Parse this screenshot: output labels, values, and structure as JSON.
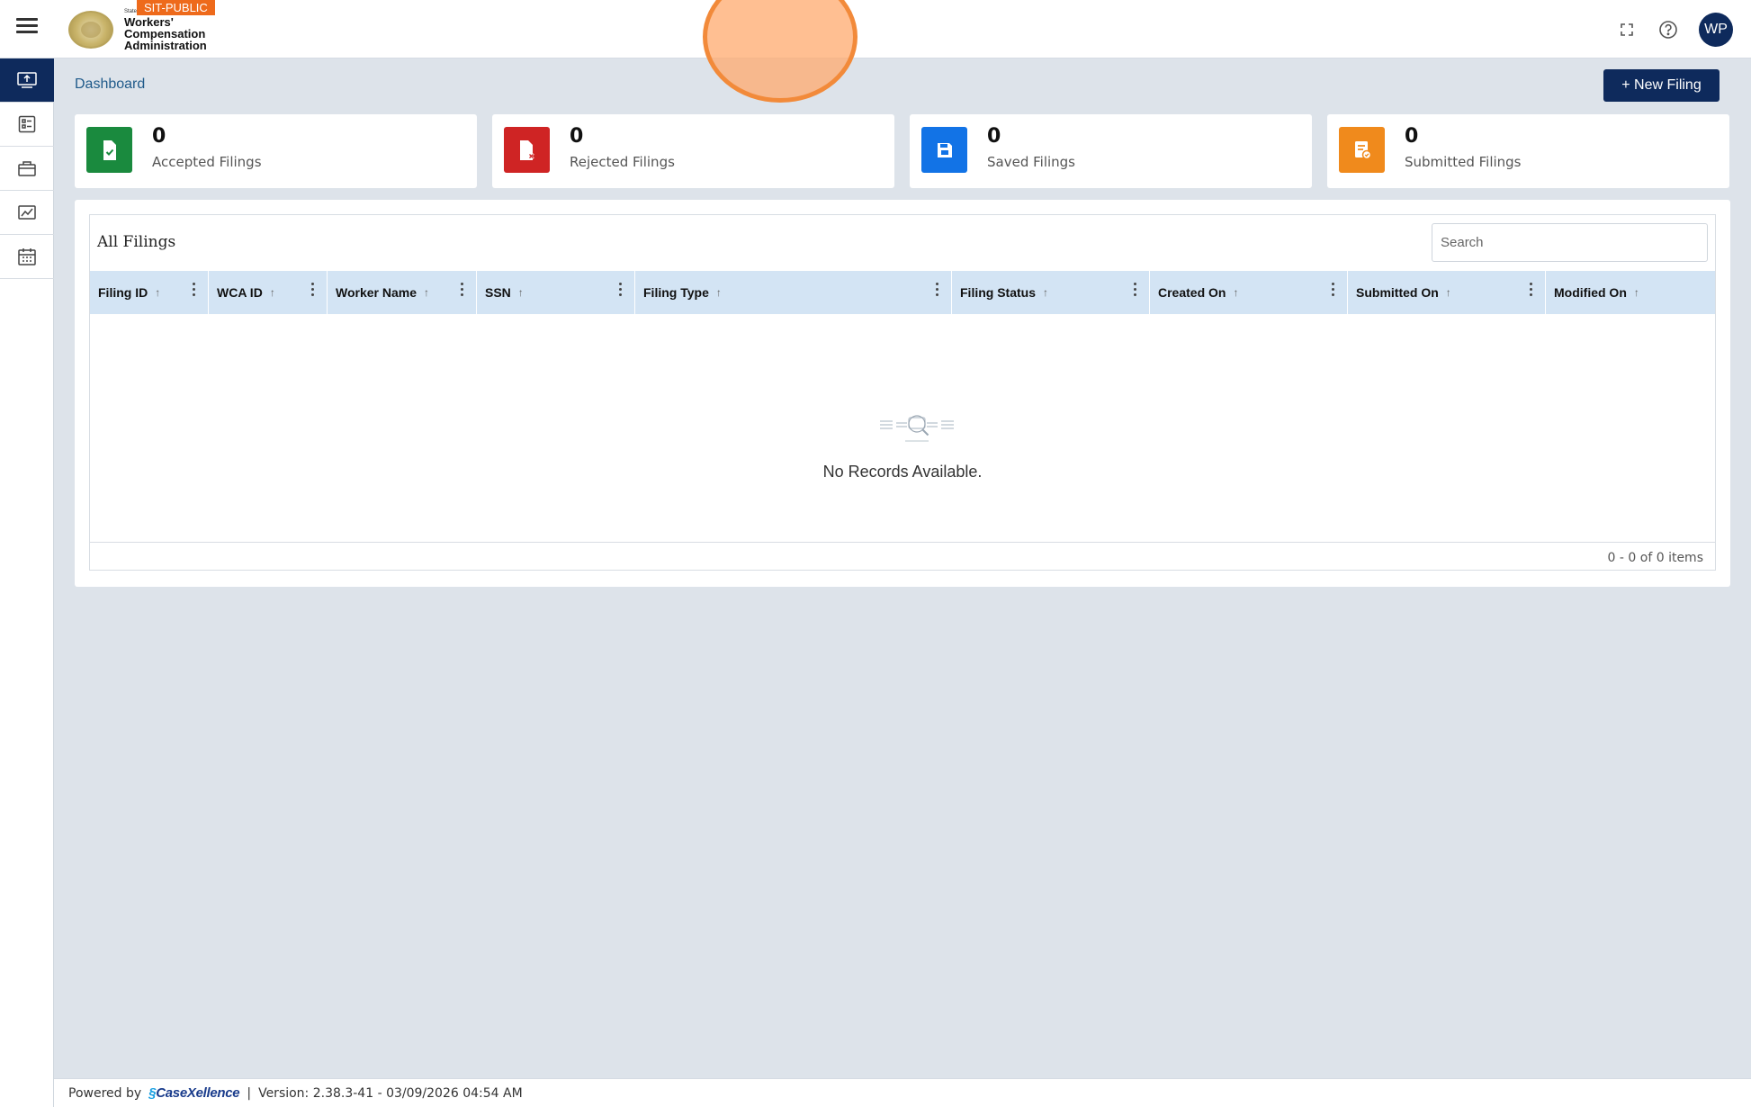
{
  "header": {
    "env_badge": "SIT-PUBLIC",
    "org_small": "State",
    "org_line1": "Workers'",
    "org_line2": "Compensation",
    "org_line3": "Administration",
    "avatar_initials": "WP",
    "icons": [
      "menu-icon",
      "fullscreen-icon",
      "help-icon"
    ]
  },
  "sidebar": {
    "items": [
      {
        "icon": "dashboard-icon",
        "active": true
      },
      {
        "icon": "list-icon",
        "active": false
      },
      {
        "icon": "briefcase-icon",
        "active": false
      },
      {
        "icon": "chart-icon",
        "active": false
      },
      {
        "icon": "calendar-icon",
        "active": false
      }
    ]
  },
  "breadcrumb": "Dashboard",
  "new_filing_label": "+ New Filing",
  "stats": [
    {
      "value": "0",
      "label": "Accepted Filings",
      "color": "#1a8a3e",
      "icon": "file-check-icon"
    },
    {
      "value": "0",
      "label": "Rejected Filings",
      "color": "#cf2424",
      "icon": "file-x-icon"
    },
    {
      "value": "0",
      "label": "Saved Filings",
      "color": "#1273e6",
      "icon": "save-icon"
    },
    {
      "value": "0",
      "label": "Submitted Filings",
      "color": "#f08a1c",
      "icon": "file-submit-icon"
    }
  ],
  "table": {
    "title": "All Filings",
    "search_placeholder": "Search",
    "columns": [
      "Filing ID",
      "WCA ID",
      "Worker Name",
      "SSN",
      "Filing Type",
      "Filing Status",
      "Created On",
      "Submitted On",
      "Modified On"
    ],
    "empty_text": "No Records Available.",
    "pager_text": "0 - 0 of 0 items"
  },
  "footer": {
    "powered_by": "Powered by",
    "brand_part1": "Case",
    "brand_part2": "Xellence",
    "separator": "|",
    "version": "Version: 2.38.3-41 - 03/09/2026 04:54 AM"
  }
}
